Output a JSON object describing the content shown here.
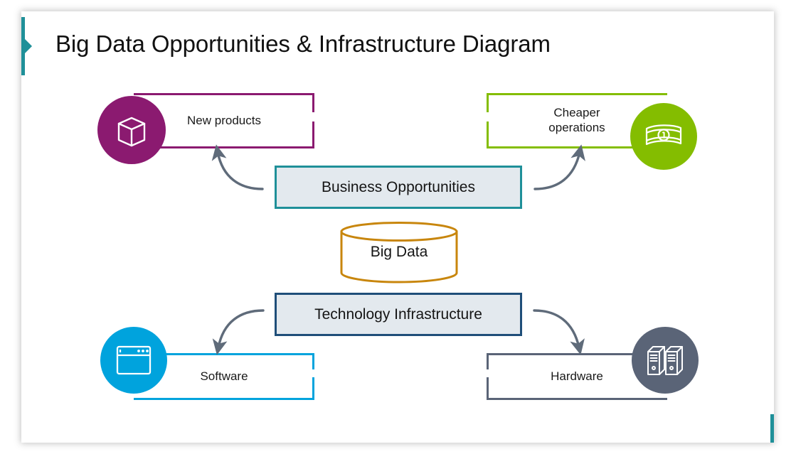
{
  "page_title": "Big Data Opportunities & Infrastructure Diagram",
  "colors": {
    "accent_teal": "#1f9099",
    "purple": "#8b1a70",
    "green": "#84bd00",
    "blue": "#00a3dd",
    "slate": "#5a6477",
    "orange": "#c8860d",
    "navy": "#1f4e79",
    "box_fill": "#e3e9ee",
    "arrow_gray": "#5f6b7a"
  },
  "center_nodes": {
    "business": {
      "label": "Business Opportunities",
      "border_color": "#1f9099",
      "fill": "#e3e9ee"
    },
    "technology": {
      "label": "Technology Infrastructure",
      "border_color": "#1f4e79",
      "fill": "#e3e9ee"
    },
    "data_store": {
      "label": "Big Data",
      "border_color": "#c8860d",
      "shape": "cylinder"
    }
  },
  "outcomes": [
    {
      "id": "new-products",
      "label": "New products",
      "color": "#8b1a70",
      "icon": "cube-icon",
      "icon_side": "left",
      "group": "business"
    },
    {
      "id": "cheaper-operations",
      "label": "Cheaper\noperations",
      "label_line1": "Cheaper",
      "label_line2": "operations",
      "color": "#84bd00",
      "icon": "banknote-icon",
      "icon_side": "right",
      "group": "business"
    },
    {
      "id": "software",
      "label": "Software",
      "color": "#00a3dd",
      "icon": "browser-window-icon",
      "icon_side": "left",
      "group": "technology"
    },
    {
      "id": "hardware",
      "label": "Hardware",
      "color": "#5a6477",
      "icon": "servers-icon",
      "icon_side": "right",
      "group": "technology"
    }
  ],
  "connectors": [
    {
      "id": "business-to-new-products",
      "from": "business",
      "to": "new-products",
      "direction": "up-left"
    },
    {
      "id": "business-to-cheaper-operations",
      "from": "business",
      "to": "cheaper-operations",
      "direction": "up-right"
    },
    {
      "id": "technology-to-software",
      "from": "technology",
      "to": "software",
      "direction": "down-left"
    },
    {
      "id": "technology-to-hardware",
      "from": "technology",
      "to": "hardware",
      "direction": "down-right"
    }
  ]
}
